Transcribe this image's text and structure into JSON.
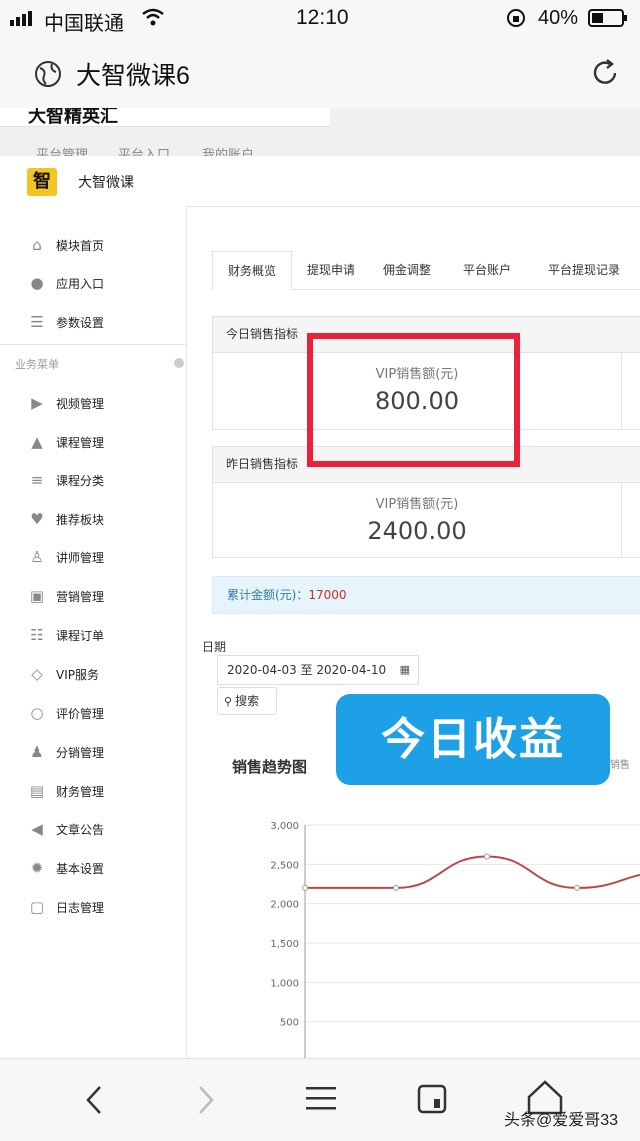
{
  "status_bar": {
    "carrier": "中国联通",
    "time": "12:10",
    "battery": "40%"
  },
  "browser": {
    "title": "大智微课6",
    "back_icon": "chevron-left-icon",
    "forward_icon": "chevron-right-icon",
    "menu_icon": "menu-icon",
    "tabs_icon": "tabs-icon",
    "home_icon": "home-icon"
  },
  "page_top": {
    "logo_text": "大智精英汇",
    "nav": [
      "平台管理",
      "平台入口",
      "我的账户"
    ]
  },
  "header": {
    "logo_char": "智",
    "brand": "大智微课"
  },
  "sidebar": {
    "top_items": [
      {
        "label": "模块首页",
        "icon": "home-icon"
      },
      {
        "label": "应用入口",
        "icon": "chat-icon"
      },
      {
        "label": "参数设置",
        "icon": "list-icon"
      }
    ],
    "section_title": "业务菜单",
    "items": [
      {
        "label": "视频管理",
        "icon": "play-icon"
      },
      {
        "label": "课程管理",
        "icon": "graduation-cap-icon"
      },
      {
        "label": "课程分类",
        "icon": "list-icon"
      },
      {
        "label": "推荐板块",
        "icon": "heart-icon"
      },
      {
        "label": "讲师管理",
        "icon": "user-icon"
      },
      {
        "label": "营销管理",
        "icon": "gift-icon"
      },
      {
        "label": "课程订单",
        "icon": "ordered-list-icon"
      },
      {
        "label": "VIP服务",
        "icon": "diamond-icon"
      },
      {
        "label": "评价管理",
        "icon": "comment-icon"
      },
      {
        "label": "分销管理",
        "icon": "users-icon"
      },
      {
        "label": "财务管理",
        "icon": "money-icon"
      },
      {
        "label": "文章公告",
        "icon": "volume-icon"
      },
      {
        "label": "基本设置",
        "icon": "gear-icon"
      },
      {
        "label": "日志管理",
        "icon": "save-icon"
      }
    ]
  },
  "tabs": [
    "财务概览",
    "提现申请",
    "佣金调整",
    "平台账户",
    "平台提现记录"
  ],
  "today": {
    "heading": "今日销售指标",
    "label": "VIP销售额(元)",
    "value": "800.00"
  },
  "yesterday": {
    "heading": "昨日销售指标",
    "label": "VIP销售额(元)",
    "value": "2400.00"
  },
  "cumulative": {
    "label": "累计金额(元)：",
    "value": "17000"
  },
  "filter": {
    "date_label": "日期",
    "date_range": "2020-04-03 至 2020-04-10",
    "search_label": "搜索"
  },
  "overlay_label": "今日收益",
  "watermark": "头条@爱爱哥33",
  "chart_data": {
    "type": "line",
    "title": "销售趋势图",
    "legend_partial": "VIP销售",
    "x": [
      "",
      "",
      "",
      "",
      ""
    ],
    "series": [
      {
        "name": "VIP销售",
        "values": [
          2200,
          2200,
          2600,
          2200,
          2400
        ],
        "color": "#b94a48"
      }
    ],
    "yticks": [
      "3,000",
      "2,500",
      "2,000",
      "1,500",
      "1,000",
      "500",
      "0"
    ],
    "ylim": [
      0,
      3000
    ]
  }
}
